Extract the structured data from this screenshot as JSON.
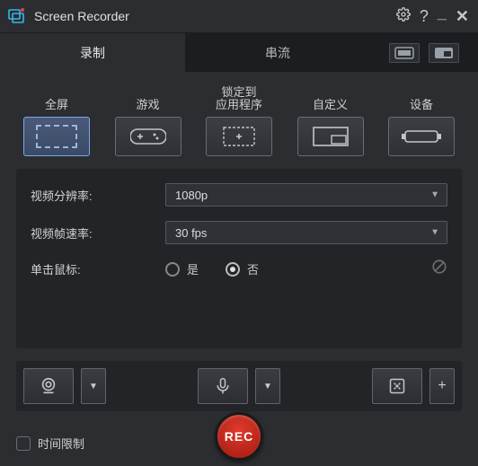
{
  "titlebar": {
    "app_name": "Screen Recorder"
  },
  "tabs": {
    "record": "录制",
    "stream": "串流"
  },
  "capture_types": {
    "fullscreen": "全屏",
    "game": "游戏",
    "lock_to_app_line1": "锁定到",
    "lock_to_app_line2": "应用程序",
    "custom": "自定义",
    "device": "设备"
  },
  "settings": {
    "resolution_label": "视频分辨率:",
    "resolution_value": "1080p",
    "framerate_label": "视频帧速率:",
    "framerate_value": "30 fps",
    "click_label": "单击鼠标:",
    "yes": "是",
    "no": "否"
  },
  "bottom": {
    "time_limit": "时间限制",
    "rec": "REC"
  }
}
